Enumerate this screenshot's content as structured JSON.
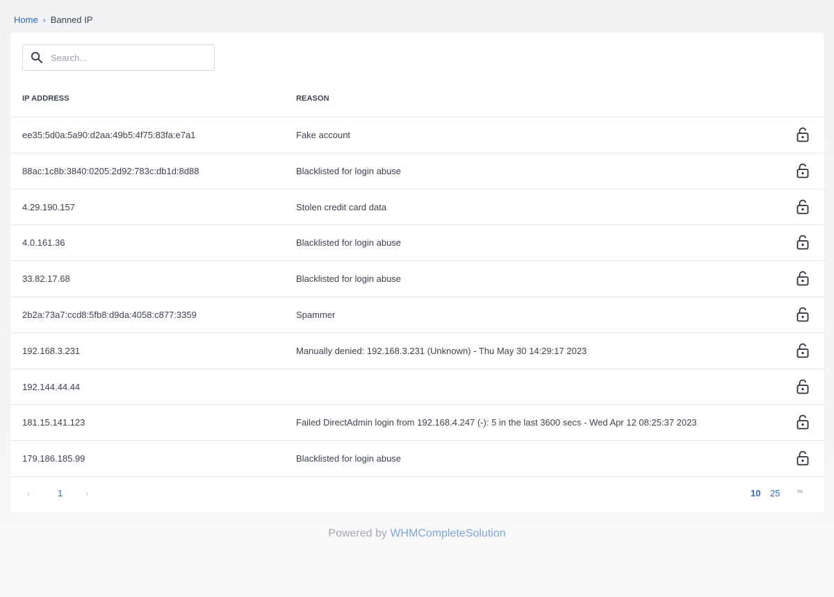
{
  "breadcrumb": {
    "home": "Home",
    "separator": "›",
    "current": "Banned IP"
  },
  "search": {
    "placeholder": "Search...",
    "value": ""
  },
  "table": {
    "headers": {
      "ip": "IP ADDRESS",
      "reason": "REASON"
    },
    "rows": [
      {
        "ip": "ee35:5d0a:5a90:d2aa:49b5:4f75:83fa:e7a1",
        "reason": "Fake account",
        "action_icon": "unlock-icon"
      },
      {
        "ip": "88ac:1c8b:3840:0205:2d92:783c:db1d:8d88",
        "reason": "Blacklisted for login abuse",
        "action_icon": "unlock-icon"
      },
      {
        "ip": "4.29.190.157",
        "reason": "Stolen credit card data",
        "action_icon": "unlock-icon"
      },
      {
        "ip": "4.0.161.36",
        "reason": "Blacklisted for login abuse",
        "action_icon": "unlock-icon"
      },
      {
        "ip": "33.82.17.68",
        "reason": "Blacklisted for login abuse",
        "action_icon": "unlock-icon"
      },
      {
        "ip": "2b2a:73a7:ccd8:5fb8:d9da:4058:c877:3359",
        "reason": "Spammer",
        "action_icon": "unlock-icon"
      },
      {
        "ip": "192.168.3.231",
        "reason": "Manually denied: 192.168.3.231 (Unknown) - Thu May 30 14:29:17 2023",
        "action_icon": "unlock-icon"
      },
      {
        "ip": "192.144.44.44",
        "reason": "",
        "action_icon": "unlock-icon"
      },
      {
        "ip": "181.15.141.123",
        "reason": "Failed DirectAdmin login from 192.168.4.247 (-): 5 in the last 3600 secs - Wed Apr 12 08:25:37 2023",
        "action_icon": "unlock-icon"
      },
      {
        "ip": "179.186.185.99",
        "reason": "Blacklisted for login abuse",
        "action_icon": "unlock-icon"
      }
    ]
  },
  "pagination": {
    "prev": "‹",
    "current_page": "1",
    "next": "›",
    "per_page_options": [
      "10",
      "25",
      "∞"
    ],
    "selected_per_page": "10"
  },
  "footer": {
    "prefix": "Powered by ",
    "brand": "WHMCompleteSolution"
  },
  "colors": {
    "link": "#2f69b3",
    "text": "#3d4250",
    "footer_brand": "#7fa6d6"
  }
}
